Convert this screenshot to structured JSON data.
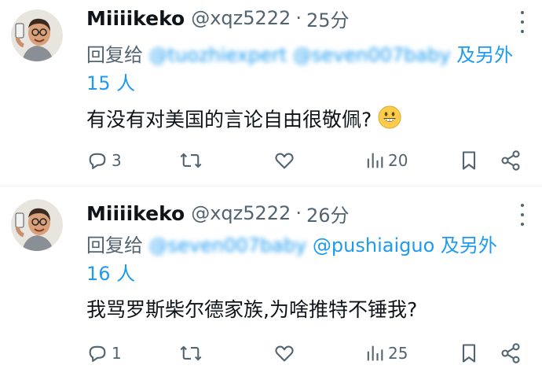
{
  "tweets": [
    {
      "name": "Miiiikeko",
      "handle": "@xqz5222",
      "separator": "·",
      "time": "25分",
      "reply_prefix": "回复给",
      "mention_1": "@tuozhiexpert",
      "mention_2": "@seven007baby",
      "reply_suffix": "及另外 15 人",
      "text": "有没有对美国的言论自由很敬佩?",
      "emoji": "grinning-face-emoji",
      "replies": "3",
      "retweets": "",
      "likes": "",
      "views": "20"
    },
    {
      "name": "Miiiikeko",
      "handle": "@xqz5222",
      "separator": "·",
      "time": "26分",
      "reply_prefix": "回复给",
      "mention_1": "@seven007baby",
      "mention_2": "@pushiaiguo",
      "reply_suffix": "及另外 16 人",
      "text": "我骂罗斯柴尔德家族,为啥推特不锤我?",
      "replies": "1",
      "retweets": "",
      "likes": "",
      "views": "25"
    }
  ],
  "icons": {
    "reply": "reply-icon",
    "retweet": "retweet-icon",
    "like": "heart-icon",
    "views": "views-icon",
    "bookmark": "bookmark-icon",
    "share": "share-icon",
    "more": "more-icon"
  },
  "colors": {
    "link": "#1d9bf0",
    "secondary": "#536471",
    "text": "#0f1419"
  }
}
